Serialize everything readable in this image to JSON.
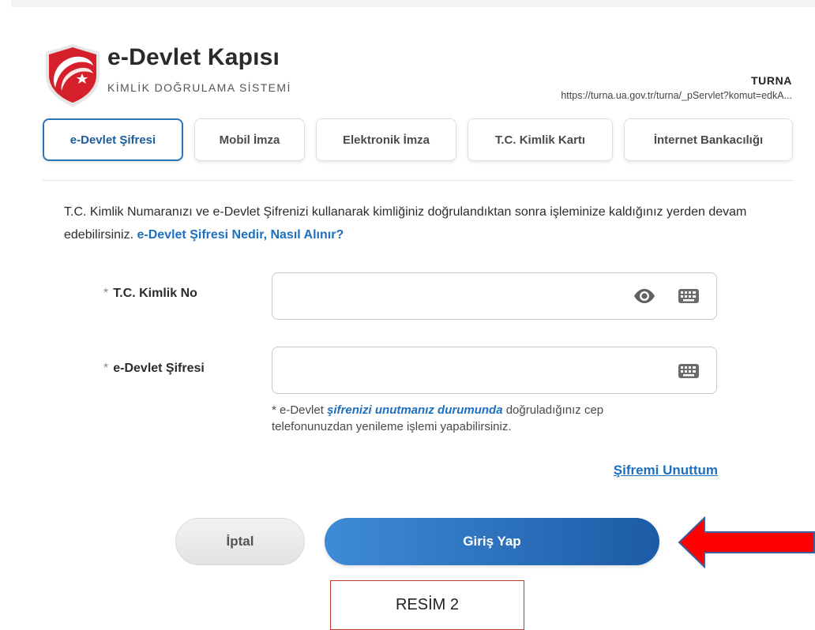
{
  "brand": {
    "title": "e-Devlet Kapısı",
    "subtitle": "KİMLİK DOĞRULAMA SİSTEMİ",
    "logo_icon": "edevlet-shield-icon",
    "logo_color": "#d5202b"
  },
  "app": {
    "name": "TURNA",
    "url": "https://turna.ua.gov.tr/turna/_pServlet?komut=edkA..."
  },
  "tabs": [
    {
      "label": "e-Devlet Şifresi",
      "active": true
    },
    {
      "label": "Mobil İmza",
      "active": false
    },
    {
      "label": "Elektronik İmza",
      "active": false
    },
    {
      "label": "T.C. Kimlik Kartı",
      "active": false
    },
    {
      "label": "İnternet Bankacılığı",
      "active": false
    }
  ],
  "intro": {
    "text": "T.C. Kimlik Numaranızı ve e-Devlet Şifrenizi kullanarak kimliğiniz doğrulandıktan sonra işleminize kaldığınız yerden devam edebilirsiniz.",
    "link": "e-Devlet Şifresi Nedir, Nasıl Alınır?"
  },
  "form": {
    "tckn": {
      "required_mark": "*",
      "label": "T.C. Kimlik No",
      "value": "",
      "icons": [
        "eye-icon",
        "keyboard-icon"
      ]
    },
    "password": {
      "required_mark": "*",
      "label": "e-Devlet Şifresi",
      "value": "",
      "icons": [
        "keyboard-icon"
      ]
    },
    "hint": {
      "prefix": "* e-Devlet",
      "emphasis": "şifrenizi unutmanız durumunda",
      "suffix": "doğruladığınız cep telefonunuzdan yenileme işlemi yapabilirsiniz."
    },
    "forgot_link": "Şifremi Unuttum"
  },
  "buttons": {
    "cancel": "İptal",
    "login": "Giriş Yap"
  },
  "annotation": {
    "caption": "RESİM 2",
    "arrow_color": "#ff0000",
    "arrow_outline": "#3b5fa0"
  },
  "colors": {
    "accent": "#1e6fbd",
    "login_gradient_start": "#3f8bd6",
    "login_gradient_end": "#1c5ba6"
  }
}
